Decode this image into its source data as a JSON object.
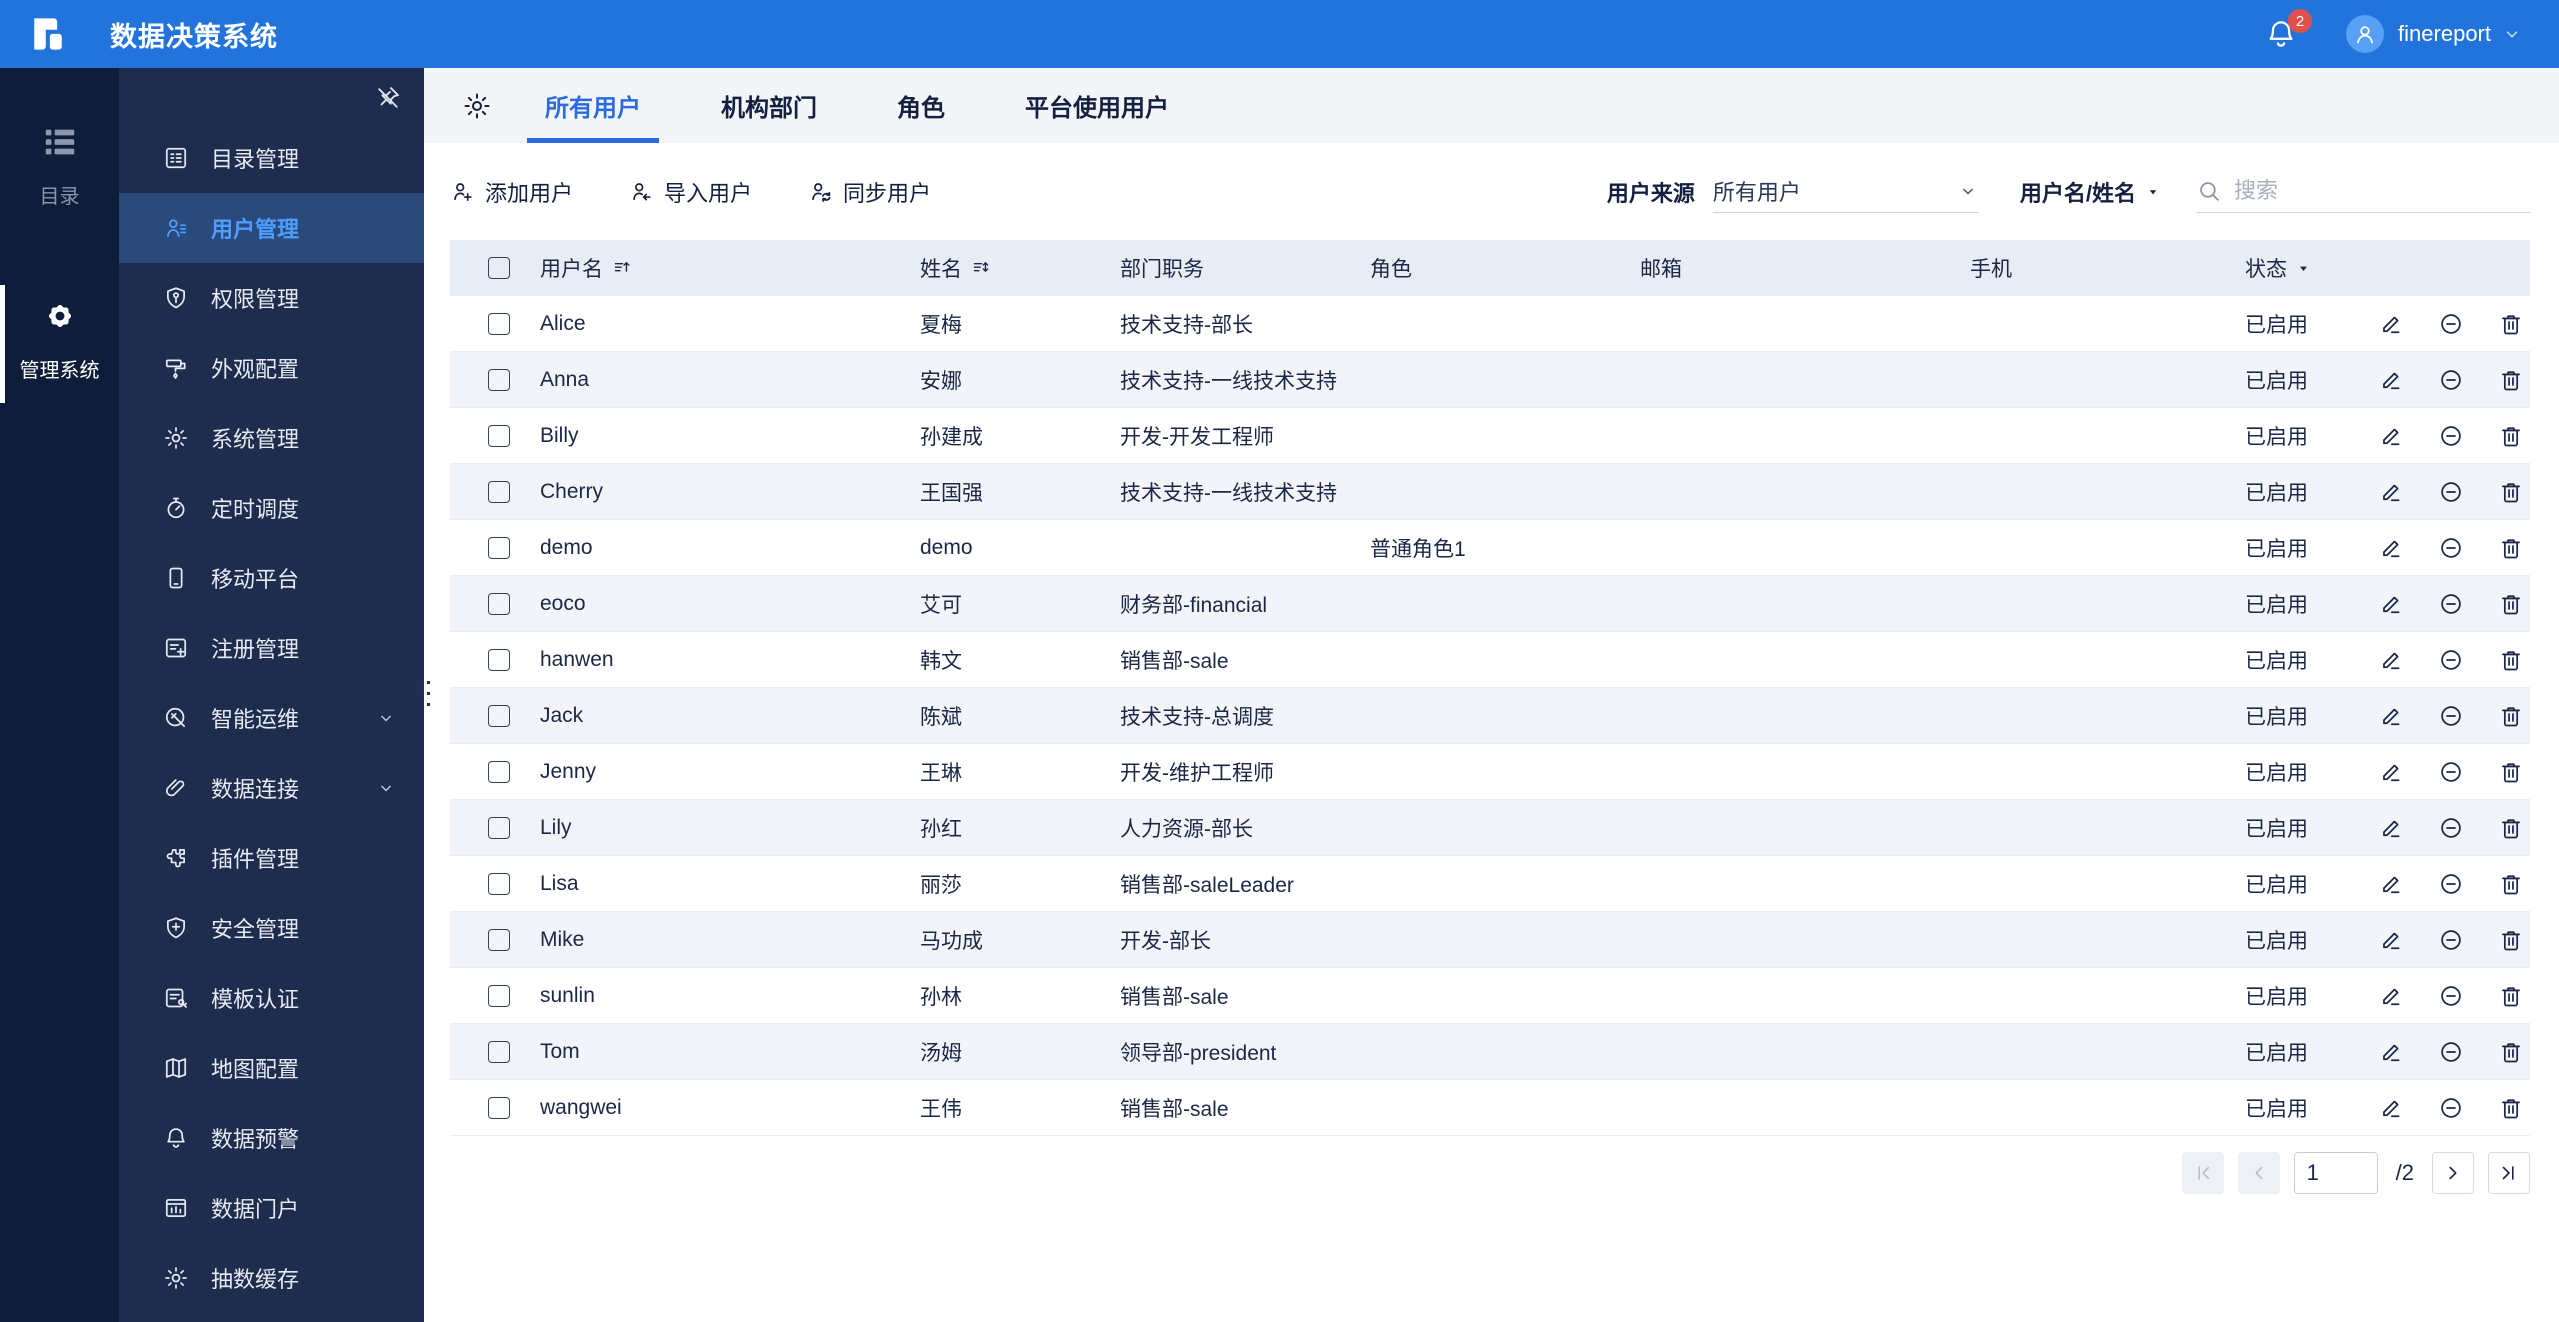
{
  "header": {
    "app_title": "数据决策系统",
    "notification_count": "2",
    "username": "finereport"
  },
  "rail": {
    "items": [
      {
        "id": "directory",
        "label": "目录",
        "icon": "rail-list",
        "active": false
      },
      {
        "id": "admin-system",
        "label": "管理系统",
        "icon": "rail-gear",
        "active": true
      }
    ]
  },
  "sidebar": {
    "items": [
      {
        "id": "catalog-management",
        "label": "目录管理",
        "icon": "doc-list",
        "active": false,
        "expandable": false
      },
      {
        "id": "user-management",
        "label": "用户管理",
        "icon": "person-list",
        "active": true,
        "expandable": false
      },
      {
        "id": "permission-management",
        "label": "权限管理",
        "icon": "shield-key",
        "active": false,
        "expandable": false
      },
      {
        "id": "appearance-config",
        "label": "外观配置",
        "icon": "paint-roller",
        "active": false,
        "expandable": false
      },
      {
        "id": "system-management",
        "label": "系统管理",
        "icon": "gear",
        "active": false,
        "expandable": false
      },
      {
        "id": "timed-schedule",
        "label": "定时调度",
        "icon": "stopwatch",
        "active": false,
        "expandable": false
      },
      {
        "id": "mobile-platform",
        "label": "移动平台",
        "icon": "phone",
        "active": false,
        "expandable": false
      },
      {
        "id": "registration-management",
        "label": "注册管理",
        "icon": "doc-plus",
        "active": false,
        "expandable": false
      },
      {
        "id": "intelligent-ops",
        "label": "智能运维",
        "icon": "wrench-circle",
        "active": false,
        "expandable": true
      },
      {
        "id": "data-connection",
        "label": "数据连接",
        "icon": "paperclip",
        "active": false,
        "expandable": true
      },
      {
        "id": "plugin-management",
        "label": "插件管理",
        "icon": "puzzle",
        "active": false,
        "expandable": false
      },
      {
        "id": "security-management",
        "label": "安全管理",
        "icon": "shield-plus",
        "active": false,
        "expandable": false
      },
      {
        "id": "template-auth",
        "label": "模板认证",
        "icon": "doc-key",
        "active": false,
        "expandable": false
      },
      {
        "id": "map-config",
        "label": "地图配置",
        "icon": "map",
        "active": false,
        "expandable": false
      },
      {
        "id": "data-alert",
        "label": "数据预警",
        "icon": "bell",
        "active": false,
        "expandable": false
      },
      {
        "id": "data-portal",
        "label": "数据门户",
        "icon": "portal",
        "active": false,
        "expandable": false
      },
      {
        "id": "data-cache",
        "label": "抽数缓存",
        "icon": "gear",
        "active": false,
        "expandable": false
      }
    ]
  },
  "tabs": {
    "items": [
      {
        "id": "all-users",
        "label": "所有用户",
        "active": true
      },
      {
        "id": "org-departments",
        "label": "机构部门",
        "active": false
      },
      {
        "id": "roles",
        "label": "角色",
        "active": false
      },
      {
        "id": "platform-users",
        "label": "平台使用用户",
        "active": false
      }
    ]
  },
  "toolbar": {
    "actions": [
      {
        "id": "add-user",
        "label": "添加用户",
        "icon": "person-plus"
      },
      {
        "id": "import-user",
        "label": "导入用户",
        "icon": "person-import"
      },
      {
        "id": "sync-user",
        "label": "同步用户",
        "icon": "person-sync"
      }
    ],
    "user_source_label": "用户来源",
    "user_source_value": "所有用户",
    "name_filter_label": "用户名/姓名",
    "search_placeholder": "搜索"
  },
  "table": {
    "columns": [
      {
        "id": "username",
        "label": "用户名",
        "icon": "sort-asc"
      },
      {
        "id": "name",
        "label": "姓名",
        "icon": "sort-both"
      },
      {
        "id": "department",
        "label": "部门职务"
      },
      {
        "id": "role",
        "label": "角色"
      },
      {
        "id": "email",
        "label": "邮箱"
      },
      {
        "id": "phone",
        "label": "手机"
      },
      {
        "id": "status",
        "label": "状态",
        "icon": "caret-down"
      }
    ],
    "rows": [
      {
        "username": "Alice",
        "name": "夏梅",
        "department": "技术支持-部长",
        "role": "",
        "email": "",
        "phone": "",
        "status": "已启用"
      },
      {
        "username": "Anna",
        "name": "安娜",
        "department": "技术支持-一线技术支持",
        "role": "",
        "email": "",
        "phone": "",
        "status": "已启用"
      },
      {
        "username": "Billy",
        "name": "孙建成",
        "department": "开发-开发工程师",
        "role": "",
        "email": "",
        "phone": "",
        "status": "已启用"
      },
      {
        "username": "Cherry",
        "name": "王国强",
        "department": "技术支持-一线技术支持",
        "role": "",
        "email": "",
        "phone": "",
        "status": "已启用"
      },
      {
        "username": "demo",
        "name": "demo",
        "department": "",
        "role": "普通角色1",
        "email": "",
        "phone": "",
        "status": "已启用"
      },
      {
        "username": "eoco",
        "name": "艾可",
        "department": "财务部-financial",
        "role": "",
        "email": "",
        "phone": "",
        "status": "已启用"
      },
      {
        "username": "hanwen",
        "name": "韩文",
        "department": "销售部-sale",
        "role": "",
        "email": "",
        "phone": "",
        "status": "已启用"
      },
      {
        "username": "Jack",
        "name": "陈斌",
        "department": "技术支持-总调度",
        "role": "",
        "email": "",
        "phone": "",
        "status": "已启用"
      },
      {
        "username": "Jenny",
        "name": "王琳",
        "department": "开发-维护工程师",
        "role": "",
        "email": "",
        "phone": "",
        "status": "已启用"
      },
      {
        "username": "Lily",
        "name": "孙红",
        "department": "人力资源-部长",
        "role": "",
        "email": "",
        "phone": "",
        "status": "已启用"
      },
      {
        "username": "Lisa",
        "name": "丽莎",
        "department": "销售部-saleLeader",
        "role": "",
        "email": "",
        "phone": "",
        "status": "已启用"
      },
      {
        "username": "Mike",
        "name": "马功成",
        "department": "开发-部长",
        "role": "",
        "email": "",
        "phone": "",
        "status": "已启用"
      },
      {
        "username": "sunlin",
        "name": "孙林",
        "department": "销售部-sale",
        "role": "",
        "email": "",
        "phone": "",
        "status": "已启用"
      },
      {
        "username": "Tom",
        "name": "汤姆",
        "department": "领导部-president",
        "role": "",
        "email": "",
        "phone": "",
        "status": "已启用"
      },
      {
        "username": "wangwei",
        "name": "王伟",
        "department": "销售部-sale",
        "role": "",
        "email": "",
        "phone": "",
        "status": "已启用"
      }
    ]
  },
  "pagination": {
    "page_value": "1",
    "total_label": "/2"
  },
  "colors": {
    "brand_blue": "#2273dc",
    "rail_navy": "#0e1d3a",
    "sidebar_navy": "#1e2c4e",
    "active_item_blue": "#4f9cff",
    "active_tab_blue": "#2b6be0",
    "badge_red": "#e2504c",
    "avatar_blue": "#57a0f5",
    "table_header_bg": "#e8ecf4",
    "row_stripe": "#f2f4f9",
    "text_navy": "#1a2747"
  }
}
